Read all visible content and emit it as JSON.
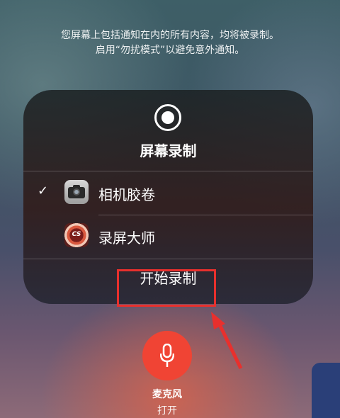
{
  "notice": {
    "line1": "您屏幕上包括通知在内的所有内容，均将被录制。",
    "line2": "启用“勿扰模式”以避免意外通知。"
  },
  "panel": {
    "title": "屏幕录制",
    "options": [
      {
        "label": "相机胶卷",
        "selected": true,
        "icon": "camera-icon"
      },
      {
        "label": "录屏大师",
        "selected": false,
        "icon": "screen-recorder-app-icon",
        "icon_text": "CS"
      }
    ],
    "check_mark": "✓",
    "start_button": "开始录制"
  },
  "microphone": {
    "label": "麦克风",
    "status": "打开"
  },
  "colors": {
    "highlight": "#e8302d",
    "mic_button": "#f04434"
  }
}
